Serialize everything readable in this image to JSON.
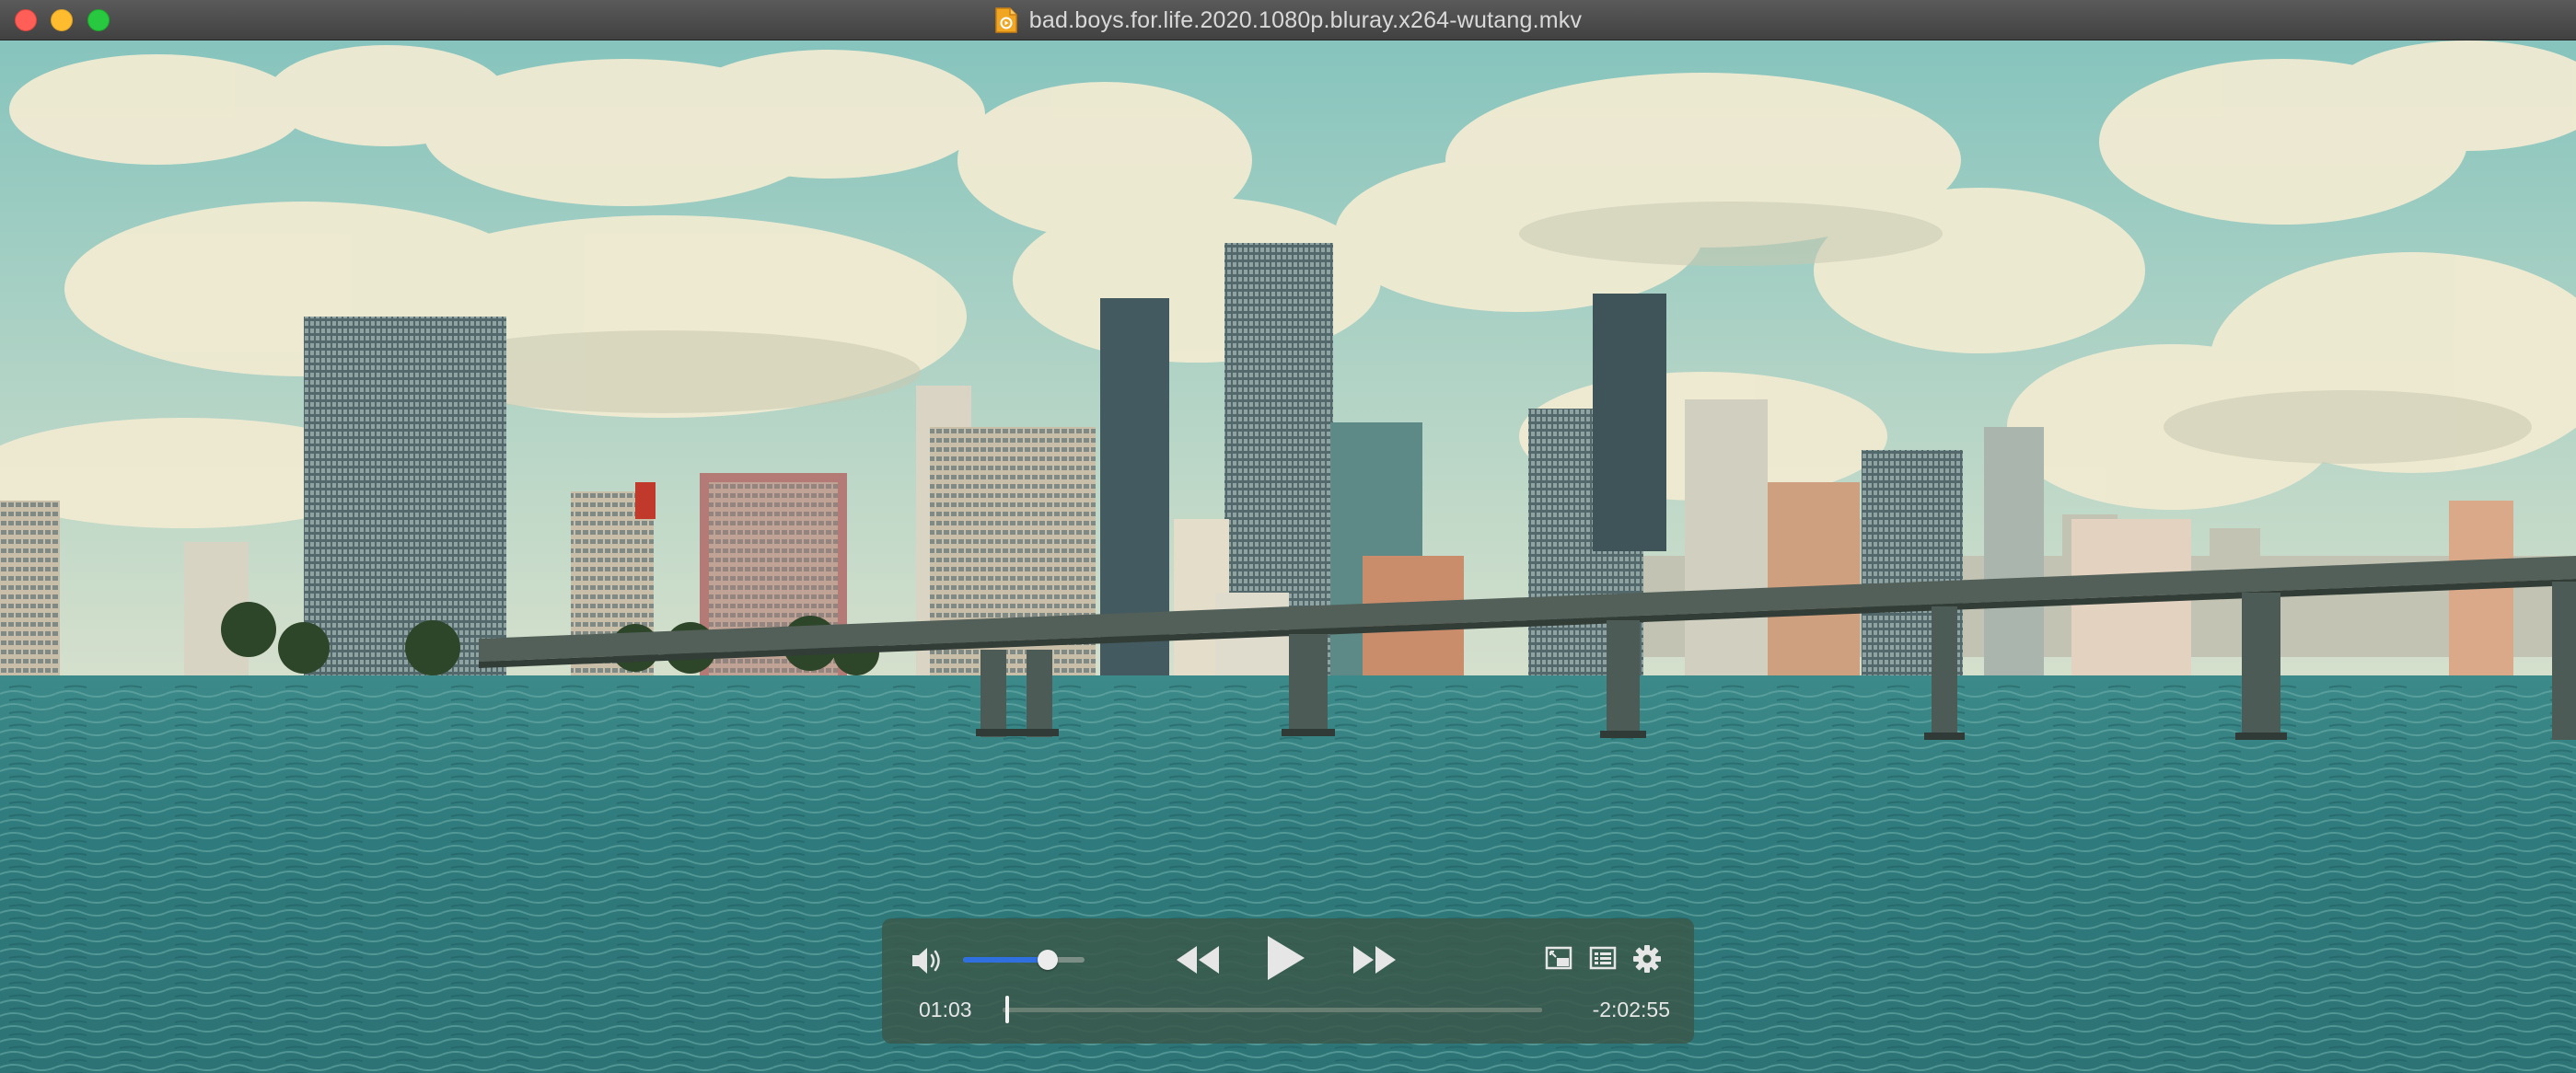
{
  "window": {
    "title": "bad.boys.for.life.2020.1080p.bluray.x264-wutang.mkv"
  },
  "icons": {
    "close": "close-light",
    "minimize": "minimize-light",
    "maximize": "maximize-light",
    "file": "video-file-icon",
    "volume": "speaker-icon",
    "rewind": "rewind-icon",
    "play": "play-icon",
    "forward": "fast-forward-icon",
    "pip": "picture-in-picture-icon",
    "playlist": "playlist-icon",
    "settings": "gear-icon"
  },
  "player": {
    "current_time": "01:03",
    "remaining_time": "-2:02:55",
    "playback_progress": 0.008,
    "volume_level": 0.7,
    "state": "paused"
  },
  "colors": {
    "accent": "#2f6fe0",
    "controls_bg": "#3a584a"
  }
}
